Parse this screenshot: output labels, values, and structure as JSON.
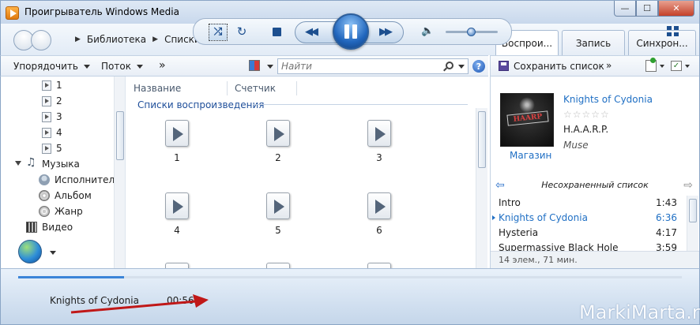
{
  "window": {
    "title": "Проигрыватель Windows Media"
  },
  "nav": {
    "breadcrumb": [
      "Библиотека",
      "Списки воспроизведения"
    ],
    "tabs": [
      {
        "label": "Воспрои...",
        "active": true
      },
      {
        "label": "Запись",
        "active": false
      },
      {
        "label": "Синхрон...",
        "active": false
      }
    ]
  },
  "toolbar": {
    "organize": "Упорядочить",
    "stream": "Поток",
    "more": "»",
    "search_placeholder": "Найти",
    "help": "?"
  },
  "sidebar": {
    "playlists": [
      "1",
      "2",
      "3",
      "4",
      "5"
    ],
    "music": "Музыка",
    "music_children": [
      "Исполнитель",
      "Альбом",
      "Жанр"
    ],
    "video": "Видео"
  },
  "content": {
    "columns": [
      "Название",
      "Счетчик"
    ],
    "group_title": "Списки воспроизведения",
    "tiles": [
      "1",
      "2",
      "3",
      "4",
      "5",
      "6"
    ]
  },
  "right_pane": {
    "save_list": "Сохранить список",
    "more": "»",
    "now_playing": {
      "song": "Knights of Cydonia",
      "rating_stars": "☆☆☆☆☆",
      "artist": "H.A.A.R.P.",
      "album": "Muse",
      "store": "Магазин",
      "cover_text": "HAARP"
    },
    "list_name": "Несохраненный список",
    "tracks": [
      {
        "name": "Intro",
        "duration": "1:43",
        "current": false
      },
      {
        "name": "Knights of Cydonia",
        "duration": "6:36",
        "current": true
      },
      {
        "name": "Hysteria",
        "duration": "4:17",
        "current": false
      },
      {
        "name": "Supermassive Black Hole",
        "duration": "3:59",
        "current": false
      }
    ],
    "footer": "14 элем., 71 мин."
  },
  "player": {
    "title": "Knights of Cydonia",
    "time": "00:56",
    "progress_fraction": 0.16,
    "volume_fraction": 0.5
  },
  "watermark": "MarkiMarta.ru",
  "colors": {
    "accent": "#1f6fc4",
    "arrow": "#c01818"
  }
}
